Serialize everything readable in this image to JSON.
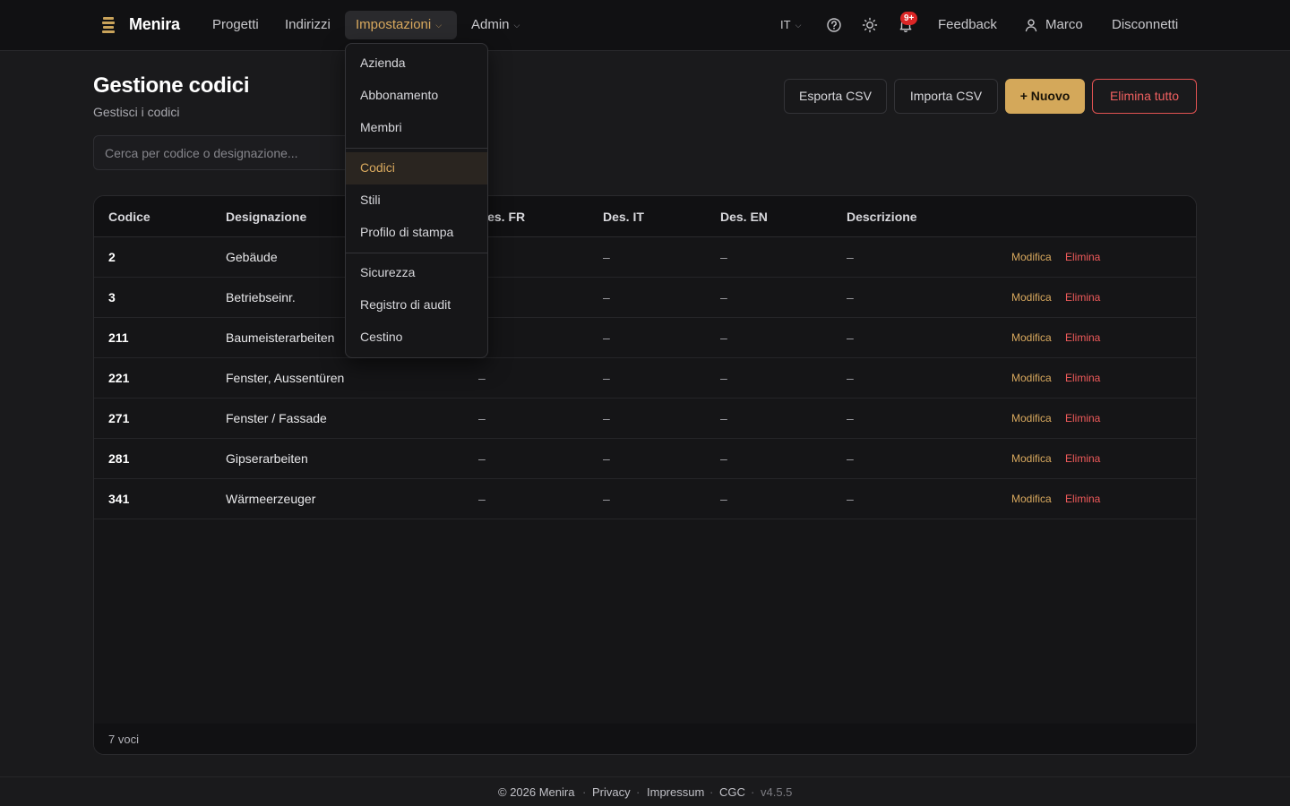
{
  "app": {
    "name": "Menira"
  },
  "nav": {
    "items": [
      {
        "label": "Progetti"
      },
      {
        "label": "Indirizzi"
      },
      {
        "label": "Impostazioni"
      },
      {
        "label": "Admin"
      }
    ],
    "language": "IT",
    "notifications_badge": "9+",
    "feedback": "Feedback",
    "user": "Marco",
    "logout": "Disconnetti"
  },
  "page": {
    "title": "Gestione codici",
    "subtitle": "Gestisci i codici",
    "search_placeholder": "Cerca per codice o designazione...",
    "buttons": {
      "export": "Esporta CSV",
      "import": "Importa CSV",
      "new": "+ Nuovo",
      "delete_all": "Elimina tutto"
    }
  },
  "table": {
    "columns": [
      "Codice",
      "Designazione",
      "Des. FR",
      "Des. IT",
      "Des. EN",
      "Descrizione"
    ],
    "rows": [
      {
        "code": "2",
        "name": "Gebäude",
        "fr": "–",
        "it": "–",
        "en": "–",
        "desc": "–"
      },
      {
        "code": "3",
        "name": "Betriebseinr.",
        "fr": "–",
        "it": "–",
        "en": "–",
        "desc": "–"
      },
      {
        "code": "211",
        "name": "Baumeisterarbeiten",
        "fr": "–",
        "it": "–",
        "en": "–",
        "desc": "–"
      },
      {
        "code": "221",
        "name": "Fenster, Aussentüren",
        "fr": "–",
        "it": "–",
        "en": "–",
        "desc": "–"
      },
      {
        "code": "271",
        "name": "Fenster / Fassade",
        "fr": "–",
        "it": "–",
        "en": "–",
        "desc": "–"
      },
      {
        "code": "281",
        "name": "Gipserarbeiten",
        "fr": "–",
        "it": "–",
        "en": "–",
        "desc": "–"
      },
      {
        "code": "341",
        "name": "Wärmeerzeuger",
        "fr": "–",
        "it": "–",
        "en": "–",
        "desc": "–"
      }
    ],
    "actions": {
      "edit": "Modifica",
      "delete": "Elimina"
    },
    "footer": "7 voci"
  },
  "dropdown": {
    "groups": [
      [
        {
          "label": "Azienda"
        },
        {
          "label": "Abbonamento"
        },
        {
          "label": "Membri"
        }
      ],
      [
        {
          "label": "Codici",
          "active": true
        },
        {
          "label": "Stili"
        },
        {
          "label": "Profilo di stampa"
        }
      ],
      [
        {
          "label": "Sicurezza"
        },
        {
          "label": "Registro di audit"
        },
        {
          "label": "Cestino"
        }
      ]
    ]
  },
  "footer": {
    "copyright": "© 2026 Menira",
    "links": [
      "Privacy",
      "Impressum",
      "CGC"
    ],
    "version": "v4.5.5"
  },
  "colors": {
    "accent": "#d4a85a",
    "danger": "#ef5a5a",
    "background": "#1a1a1c",
    "navbar": "#111113"
  },
  "icons": [
    "menira-logo-icon",
    "chevron-down-icon",
    "help-icon",
    "sun-icon",
    "bell-icon",
    "user-icon"
  ]
}
